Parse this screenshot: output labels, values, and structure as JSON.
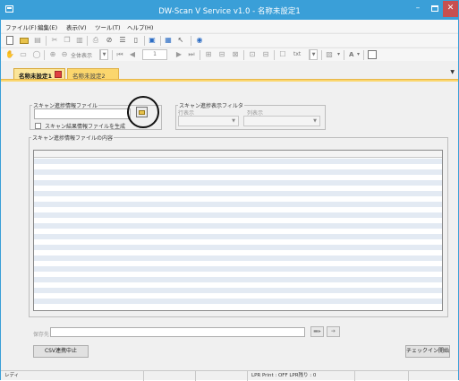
{
  "window": {
    "title": "DW-Scan V Service v1.0 - 名称未設定1"
  },
  "menu": [
    "ファイル(F)",
    "編集(E)",
    "表示(V)",
    "ツール(T)",
    "ヘルプ(H)"
  ],
  "toolbar2": {
    "zoom_fit": "全体表示",
    "page_value": "1",
    "txt_label": "txt",
    "font_label": "A"
  },
  "tabs": [
    {
      "label": "名称未設定1",
      "active": true
    },
    {
      "label": "名称未設定2",
      "active": false
    }
  ],
  "scan_file_group": {
    "legend": "スキャン進捗情報ファイル",
    "path_value": "",
    "checkbox_label": "スキャン結果情報ファイルを生成",
    "checkbox_checked": false
  },
  "filter_group": {
    "legend": "スキャン進捗表示フィルタ",
    "row_label": "行表示",
    "col_label": "列表示",
    "row_value": "",
    "col_value": ""
  },
  "contents_group": {
    "legend": "スキャン進捗情報ファイルの内容"
  },
  "save": {
    "label": "保存先",
    "path_value": ""
  },
  "buttons": {
    "csv_stop": "CSV連携中止",
    "checkin_start": "チェックイン開始"
  },
  "status": {
    "ready": "レディ",
    "lpr": "LPR Print : OFF   LPR残り : 0"
  },
  "colors": {
    "titlebar": "#3a9fd8",
    "tab_active": "#fbe599",
    "tab_inactive": "#fbd66d",
    "grid_stripe": "#e3eaf3",
    "close_button": "#c75050"
  }
}
